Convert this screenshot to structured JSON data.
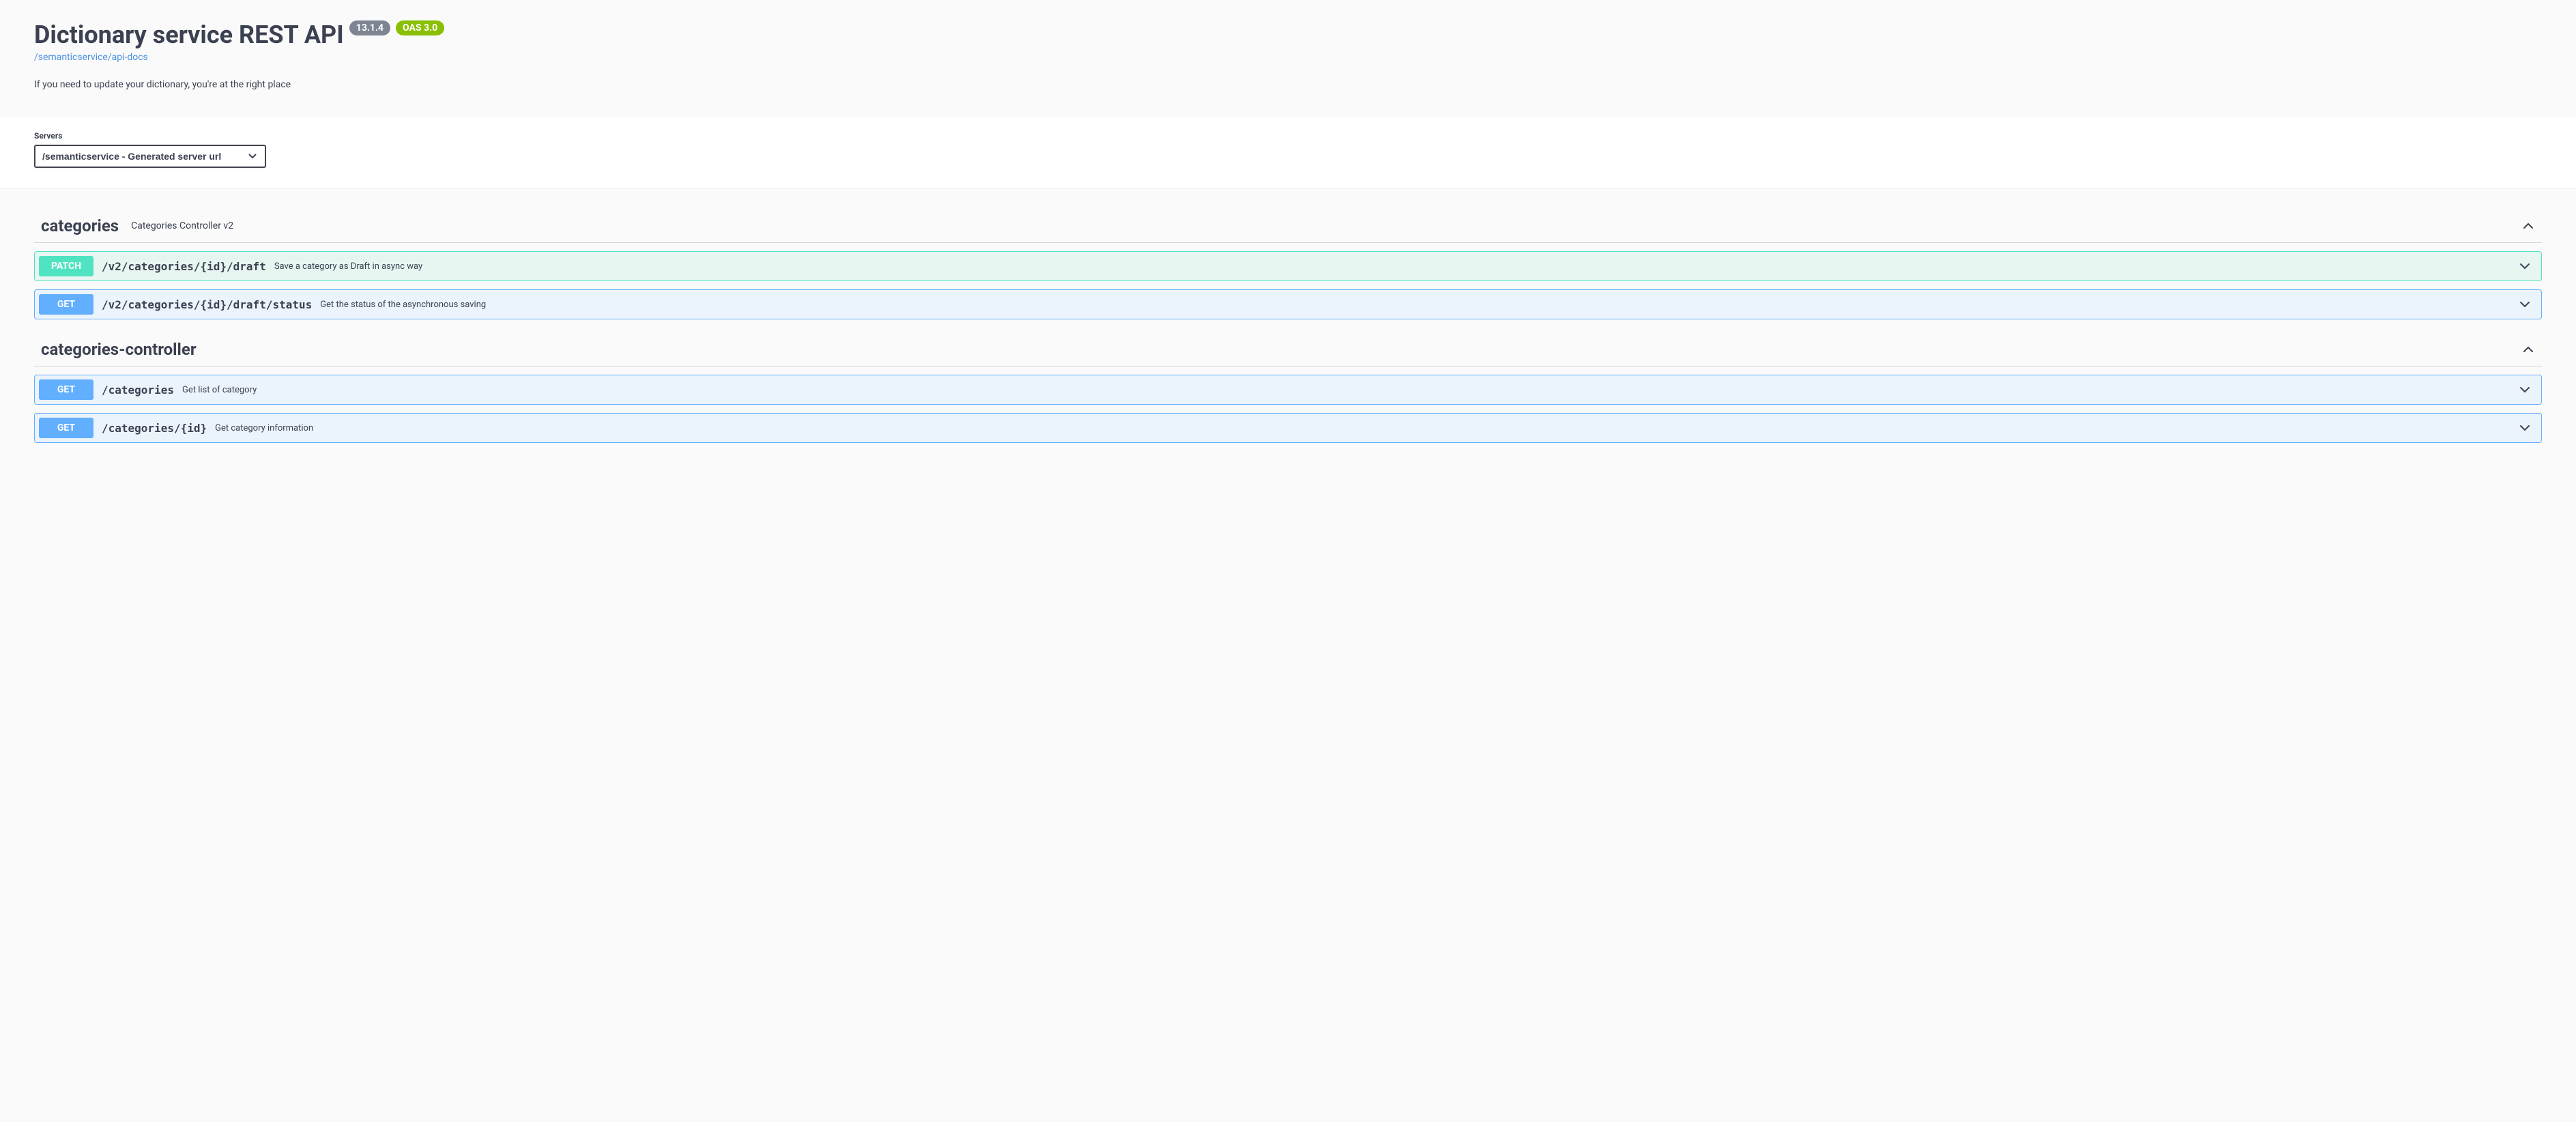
{
  "header": {
    "title": "Dictionary service REST API",
    "version": "13.1.4",
    "oas": "OAS 3.0",
    "docs_link": "/semanticservice/api-docs",
    "description": "If you need to update your dictionary, you're at the right place"
  },
  "servers": {
    "label": "Servers",
    "selected": "/semanticservice - Generated server url"
  },
  "tags": [
    {
      "name": "categories",
      "description": "Categories Controller v2",
      "operations": [
        {
          "method": "PATCH",
          "path": "/v2/categories/{id}/draft",
          "summary": "Save a category as Draft in async way"
        },
        {
          "method": "GET",
          "path": "/v2/categories/{id}/draft/status",
          "summary": "Get the status of the asynchronous saving"
        }
      ]
    },
    {
      "name": "categories-controller",
      "description": "",
      "operations": [
        {
          "method": "GET",
          "path": "/categories",
          "summary": "Get list of category"
        },
        {
          "method": "GET",
          "path": "/categories/{id}",
          "summary": "Get category information"
        }
      ]
    }
  ]
}
